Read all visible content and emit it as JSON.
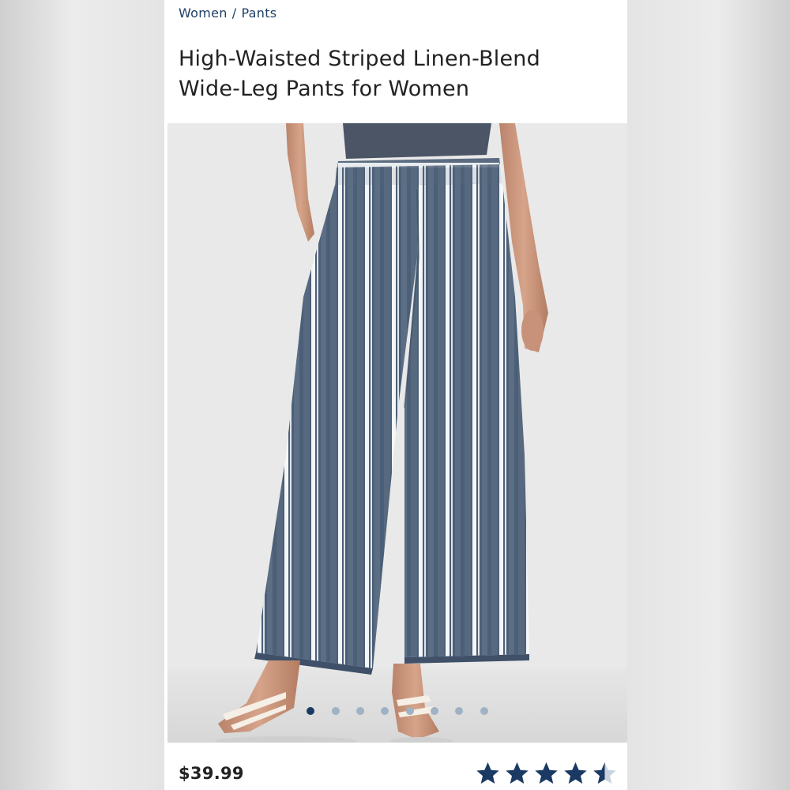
{
  "breadcrumb": {
    "items": [
      "Women",
      "Pants"
    ],
    "separator": "/"
  },
  "product": {
    "title": "High-Waisted Striped Linen-Blend Wide-Leg Pants for Women",
    "price": "$39.99",
    "rating": 4.5,
    "rating_max": 5
  },
  "gallery": {
    "image_count": 8,
    "active_index": 0,
    "image_description_icon": "product-photo"
  },
  "colors": {
    "brand_navy": "#1b3a63",
    "dot_inactive": "#9fb2c4",
    "text_dark": "#222222",
    "star_fill": "#1b3a63"
  }
}
